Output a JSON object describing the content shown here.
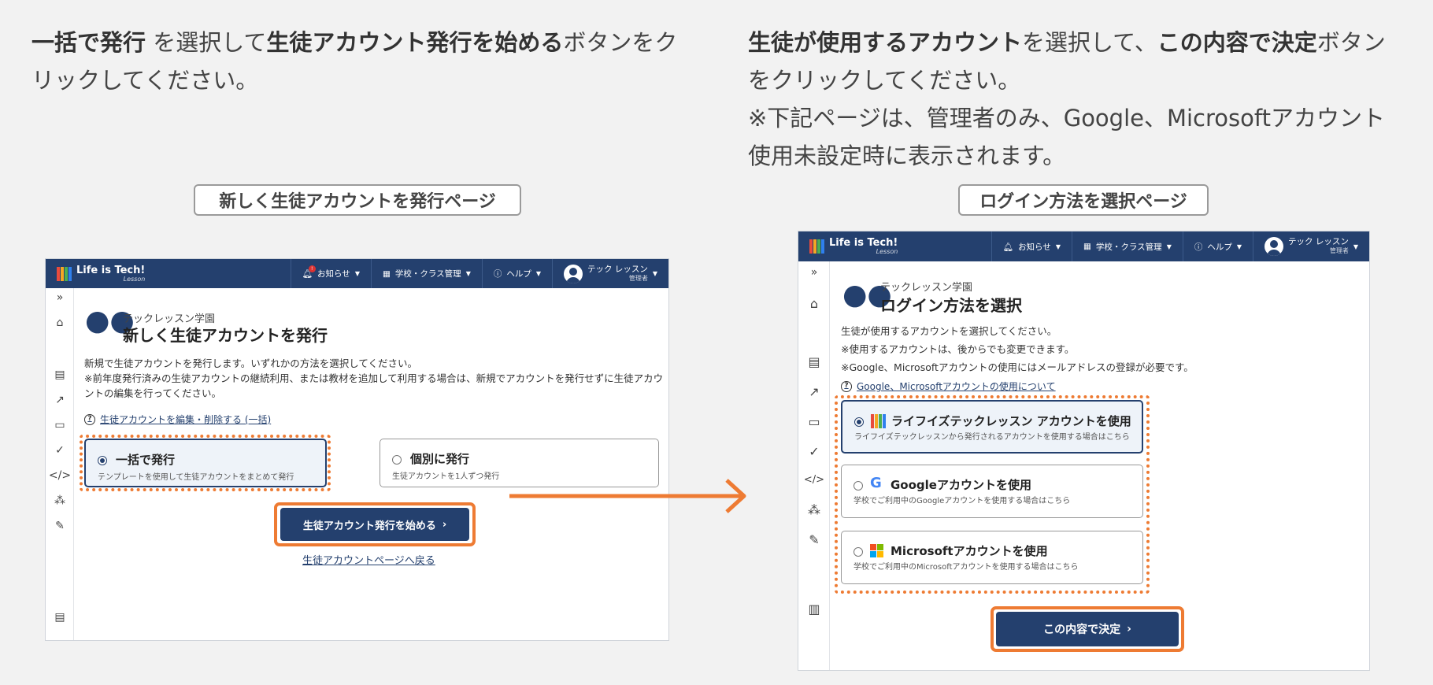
{
  "instructions": {
    "left": {
      "parts": [
        {
          "text": "一括で発行",
          "bold": true
        },
        {
          "text": " を選択して",
          "bold": false
        },
        {
          "text": "生徒アカウント発行を始める",
          "bold": true
        },
        {
          "text": "ボタンをクリックしてください。",
          "bold": false
        }
      ]
    },
    "right": {
      "parts": [
        {
          "text": "生徒が使用するアカウント",
          "bold": true
        },
        {
          "text": "を選択して、",
          "bold": false
        },
        {
          "text": "この内容で決定",
          "bold": true
        },
        {
          "text": "ボタンをクリックしてください。",
          "bold": false
        }
      ],
      "note": "※下記ページは、管理者のみ、Google、Microsoftアカウント使用未設定時に表示されます。"
    }
  },
  "labels": {
    "left_page": "新しく生徒アカウントを発行ページ",
    "right_page": "ログイン方法を選択ページ"
  },
  "app": {
    "logo_text": "Life is Tech!",
    "logo_sub": "Lesson",
    "logo_colors": [
      "#e94b3c",
      "#f5a623",
      "#4caf50",
      "#2f80ed",
      "#9b51e0"
    ],
    "nav": {
      "notifications": "お知らせ",
      "notification_badge": "!",
      "school_class": "学校・クラス管理",
      "help": "ヘルプ",
      "user_name": "テック レッスン",
      "user_role": "管理者"
    },
    "school_name": "テックレッスン学園"
  },
  "left_screen": {
    "title": "新しく生徒アカウントを発行",
    "desc1": "新規で生徒アカウントを発行します。いずれかの方法を選択してください。",
    "desc2": "※前年度発行済みの生徒アカウントの継続利用、または教材を追加して利用する場合は、新規でアカウントを発行せずに生徒アカウントの編集を行ってください。",
    "help_link": "生徒アカウントを編集・削除する (一括)",
    "options": [
      {
        "title": "一括で発行",
        "sub": "テンプレートを使用して生徒アカウントをまとめて発行",
        "selected": true
      },
      {
        "title": "個別に発行",
        "sub": "生徒アカウントを1人ずつ発行",
        "selected": false
      }
    ],
    "start_button": "生徒アカウント発行を始める",
    "back_link": "生徒アカウントページへ戻る"
  },
  "right_screen": {
    "title": "ログイン方法を選択",
    "desc1": "生徒が使用するアカウントを選択してください。",
    "desc2": "※使用するアカウントは、後からでも変更できます。",
    "desc3": "※Google、Microsoftアカウントの使用にはメールアドレスの登録が必要です。",
    "help_link": "Google、Microsoftアカウントの使用について",
    "options": [
      {
        "title": "ライフイズテックレッスン アカウントを使用",
        "sub": "ライフイズテックレッスンから発行されるアカウントを使用する場合はこちら",
        "selected": true,
        "icon": "lifeistech-icon"
      },
      {
        "title": "Googleアカウントを使用",
        "sub": "学校でご利用中のGoogleアカウントを使用する場合はこちら",
        "selected": false,
        "icon": "google-icon"
      },
      {
        "title": "Microsoftアカウントを使用",
        "sub": "学校でご利用中のMicrosoftアカウントを使用する場合はこちら",
        "selected": false,
        "icon": "microsoft-icon"
      }
    ],
    "decide_button": "この内容で決定"
  },
  "colors": {
    "navy": "#24406e",
    "highlight_orange": "#ee7b33"
  }
}
